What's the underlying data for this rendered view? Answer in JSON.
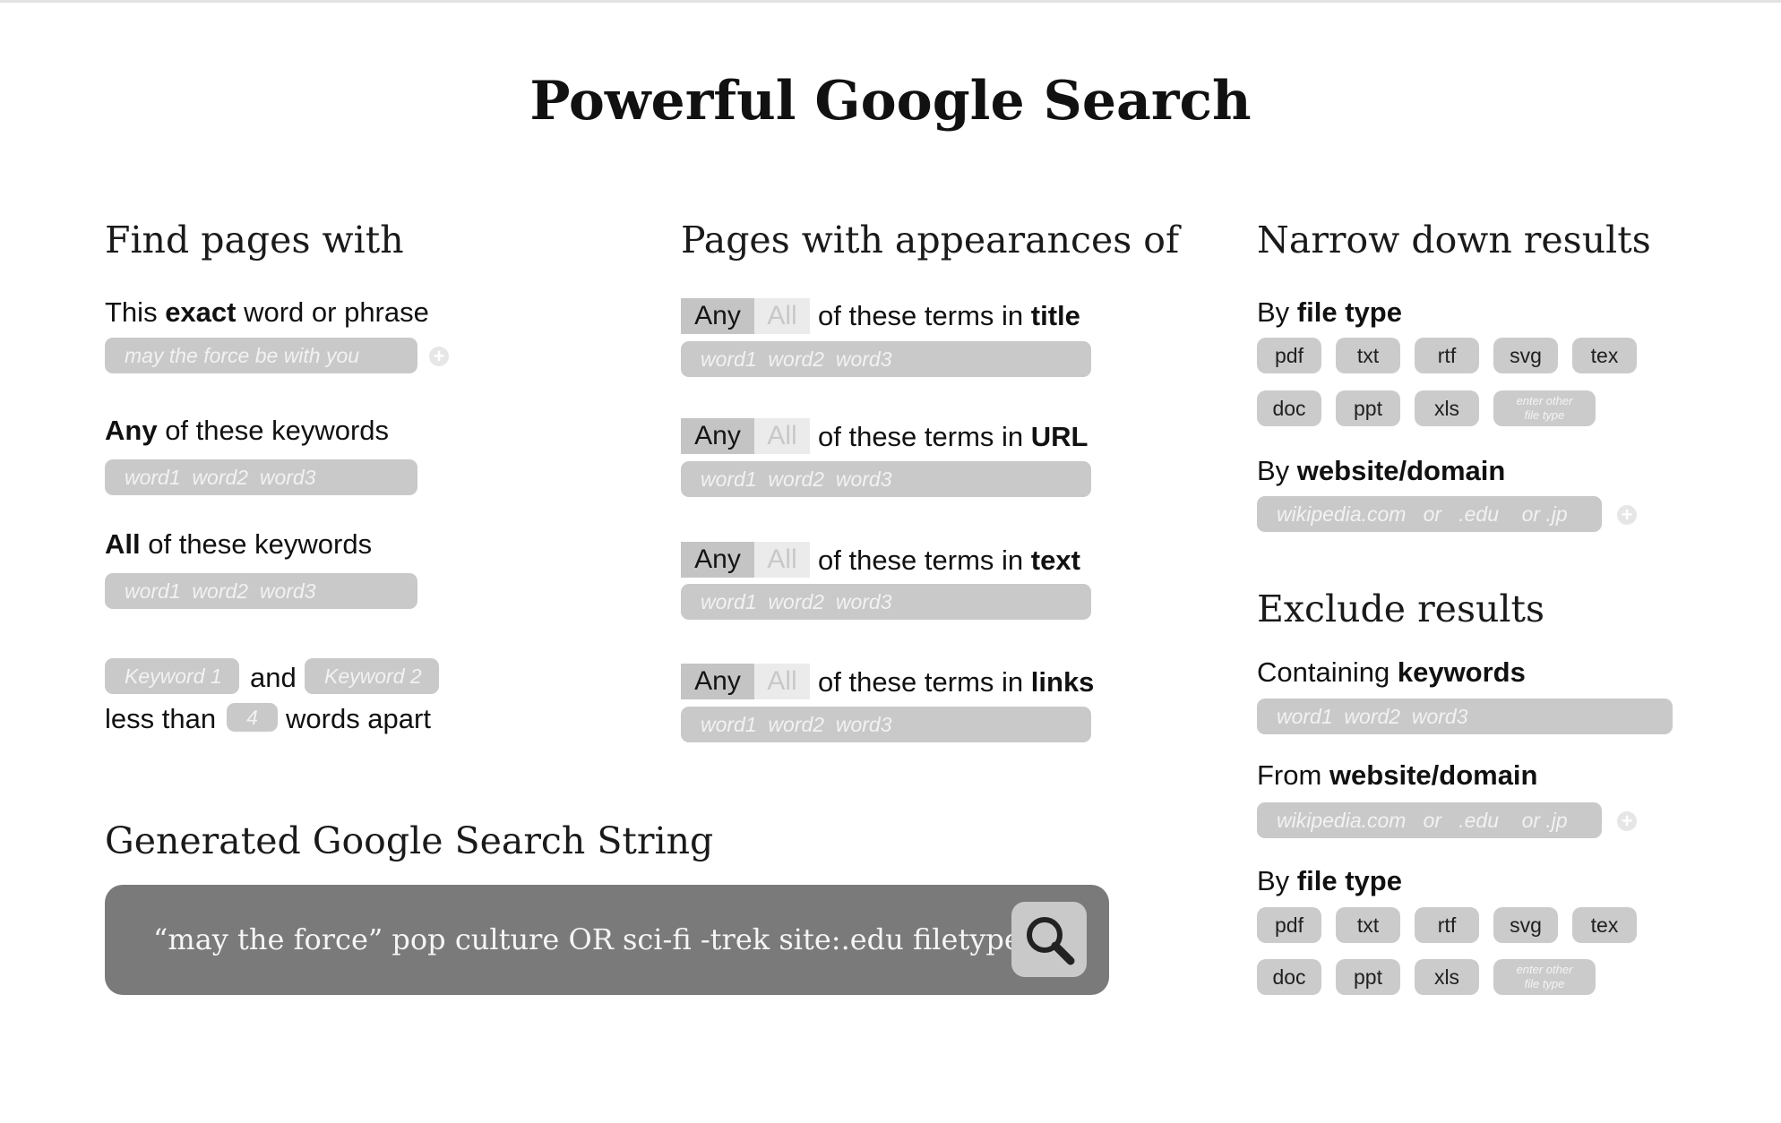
{
  "title": "Powerful Google Search",
  "find_pages": {
    "heading": "Find pages with",
    "exact": {
      "pre": "This ",
      "bold": "exact",
      "post": " word or phrase",
      "placeholder": "may the force be with you"
    },
    "any": {
      "bold": "Any",
      "post": " of these keywords",
      "placeholder": "word1  word2  word3"
    },
    "all": {
      "bold": "All",
      "post": " of these keywords",
      "placeholder": "word1  word2  word3"
    },
    "proximity": {
      "keyword1": "Keyword 1",
      "and": "and",
      "keyword2": "Keyword 2",
      "less_than": "less than",
      "distance": "4",
      "words_apart": "words apart"
    }
  },
  "appearances": {
    "heading": "Pages with appearances of",
    "any_label": "Any",
    "all_label": "All",
    "prefix": "of these terms in ",
    "rows": [
      {
        "target": "title",
        "placeholder": "word1  word2  word3"
      },
      {
        "target": "URL",
        "placeholder": "word1  word2  word3"
      },
      {
        "target": "text",
        "placeholder": "word1  word2  word3"
      },
      {
        "target": "links",
        "placeholder": "word1  word2  word3"
      }
    ]
  },
  "narrow": {
    "heading": "Narrow down results",
    "filetype": {
      "pre": "By ",
      "bold": "file type"
    },
    "chips": [
      "pdf",
      "txt",
      "rtf",
      "svg",
      "tex",
      "doc",
      "ppt",
      "xls"
    ],
    "other_chip": [
      "enter other",
      "file type"
    ],
    "domain": {
      "pre": "By ",
      "bold": "website/domain",
      "placeholder": "wikipedia.com   or   .edu    or .jp"
    }
  },
  "exclude": {
    "heading": "Exclude results",
    "keywords": {
      "pre": "Containing ",
      "bold": "keywords",
      "placeholder": "word1  word2  word3"
    },
    "domain": {
      "pre": "From ",
      "bold": "website/domain",
      "placeholder": "wikipedia.com   or   .edu    or .jp"
    },
    "filetype": {
      "pre": "By ",
      "bold": "file type"
    },
    "chips": [
      "pdf",
      "txt",
      "rtf",
      "svg",
      "tex",
      "doc",
      "ppt",
      "xls"
    ],
    "other_chip": [
      "enter other",
      "file type"
    ]
  },
  "generated": {
    "heading": "Generated Google Search String",
    "value": "“may the force” pop culture OR sci-fi -trek site:.edu filetype:pdf",
    "search_icon": "search-icon"
  },
  "colors": {
    "field": "#c9c9c9",
    "result_bar": "#7a7a7a",
    "toggle_any": "#c4c4c4",
    "toggle_all": "#ebebeb"
  }
}
